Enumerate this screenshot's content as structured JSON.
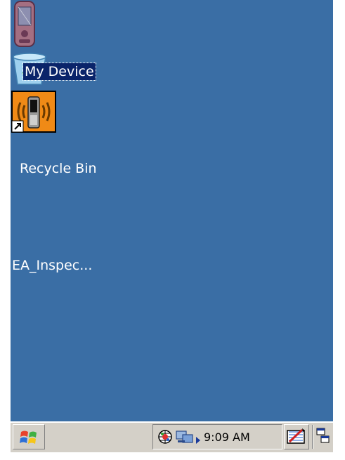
{
  "desktop": {
    "background_color": "#3a6ea5",
    "icons": [
      {
        "label": "My Device",
        "icon": "my-device-icon",
        "selected": true
      },
      {
        "label": "Recycle Bin",
        "icon": "recycle-bin-icon",
        "selected": false
      },
      {
        "label": "EA_Inspec...",
        "icon": "ea-inspector-shortcut-icon",
        "selected": false
      }
    ]
  },
  "taskbar": {
    "start_icon": "windows-start-icon",
    "tray_icons": [
      "network-globe-icon",
      "network-connection-icon",
      "tray-expand-arrow-icon"
    ],
    "clock": "9:09 AM",
    "input_icon": "input-panel-icon",
    "switcher_icon": "window-switcher-icon"
  }
}
